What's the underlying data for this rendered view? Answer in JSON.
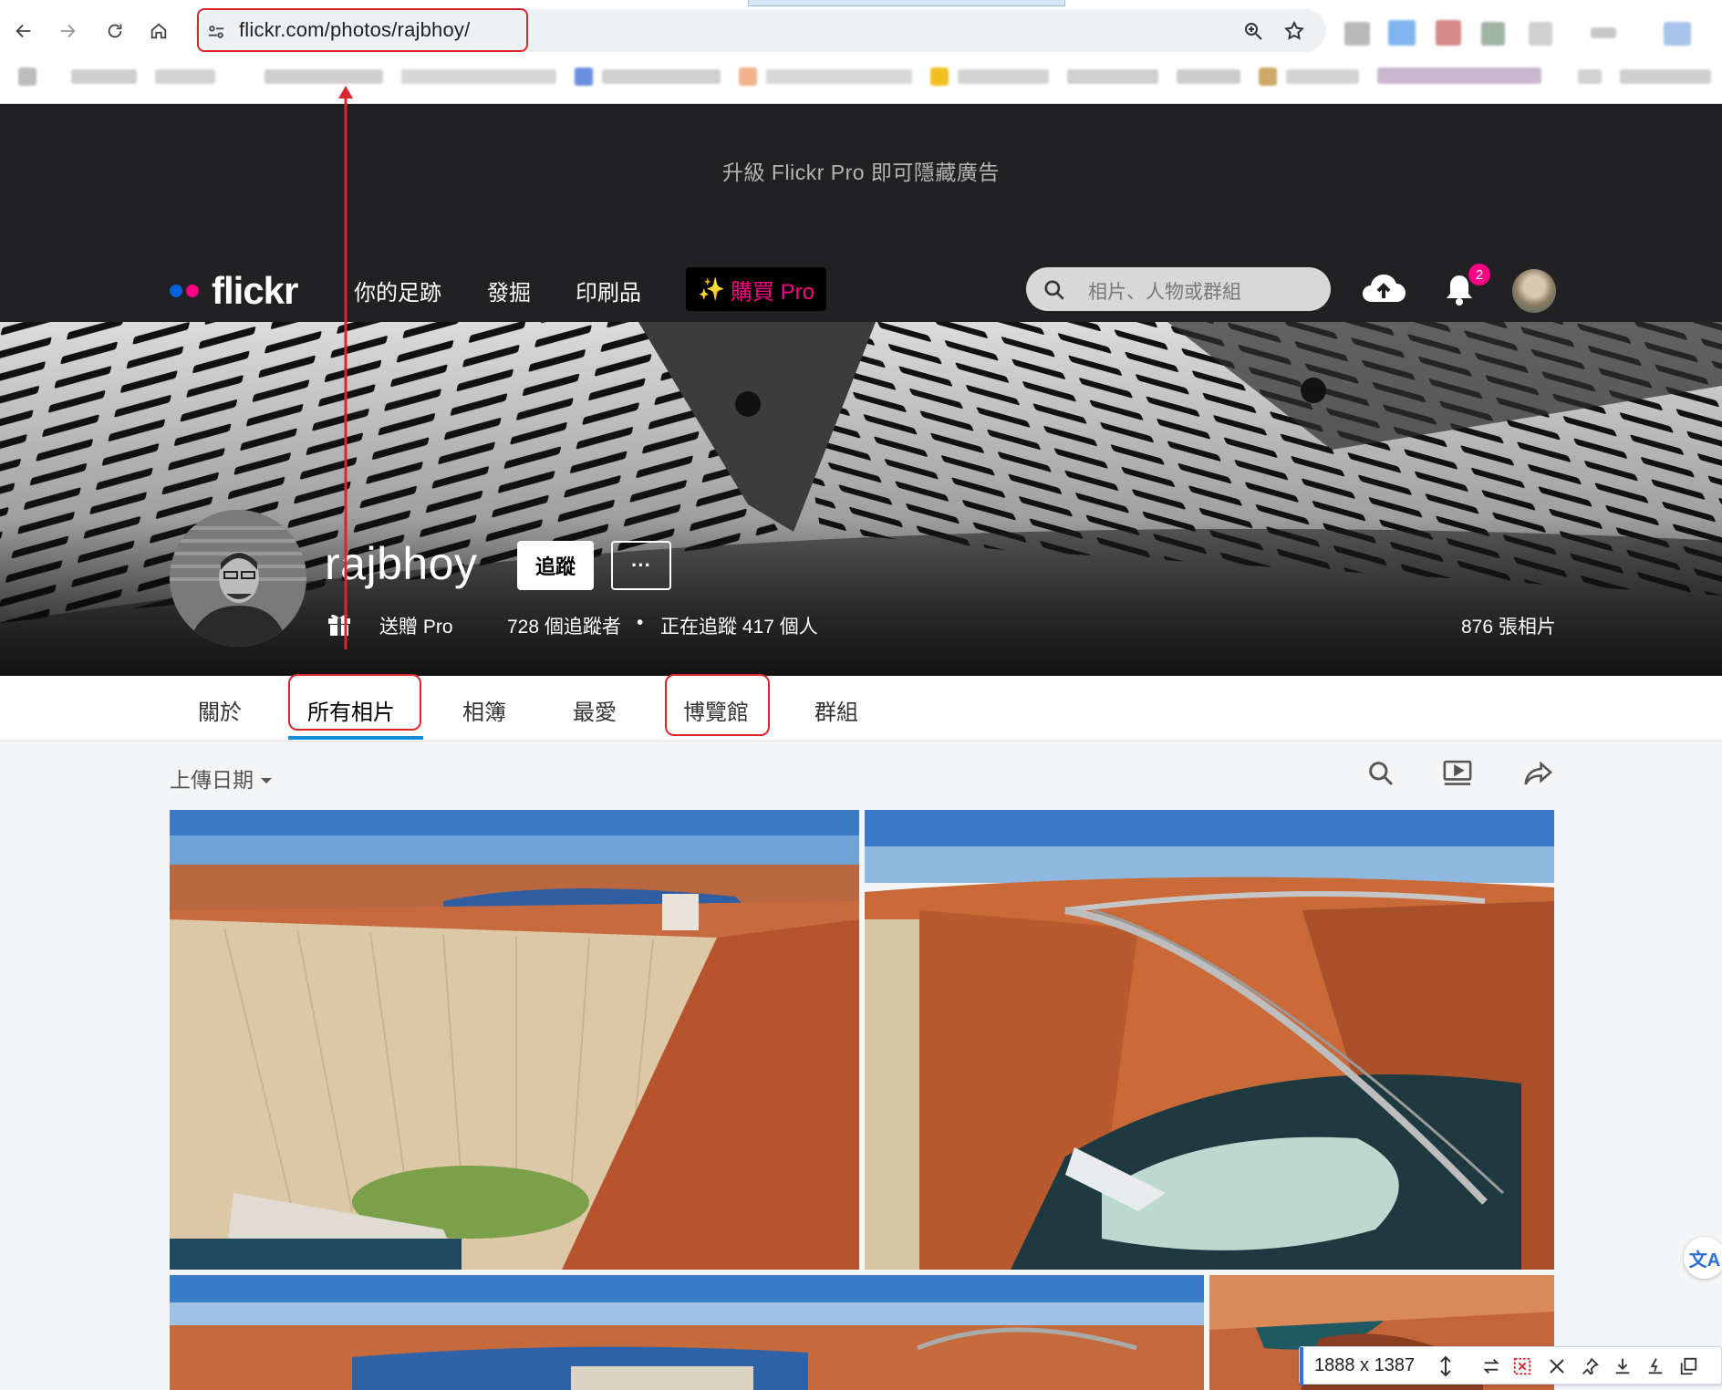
{
  "browser": {
    "url": "flickr.com/photos/rajbhoy/",
    "icons": [
      "back-arrow-icon",
      "forward-arrow-icon",
      "reload-icon",
      "home-icon",
      "site-settings-icon",
      "zoom-icon",
      "star-icon"
    ]
  },
  "ad": {
    "text": "升級 Flickr Pro 即可隱藏廣告"
  },
  "flickr_nav": {
    "logo": "flickr",
    "links": [
      "你的足跡",
      "發掘",
      "印刷品"
    ],
    "pro_button": "購買 Pro",
    "pro_sparkle": "✨",
    "search_placeholder": "相片、人物或群組",
    "notification_count": "2",
    "colors": {
      "blue_dot": "#0063dc",
      "pink_dot": "#ff0084",
      "bar": "#212124"
    }
  },
  "profile": {
    "username": "rajbhoy",
    "follow_button": "追蹤",
    "more_button": "···",
    "gift_pro": "送贈 Pro",
    "followers": "728 個追蹤者",
    "separator": "•",
    "following": "正在追蹤 417 個人",
    "photo_count": "876 張相片"
  },
  "tabs": [
    "關於",
    "所有相片",
    "相簿",
    "最愛",
    "博覽館",
    "群組"
  ],
  "active_tab": "所有相片",
  "toolbar": {
    "sort_label": "上傳日期"
  },
  "screenshot_tool": {
    "size": "1888 x 1387"
  },
  "translate": {
    "glyph": "文A"
  }
}
